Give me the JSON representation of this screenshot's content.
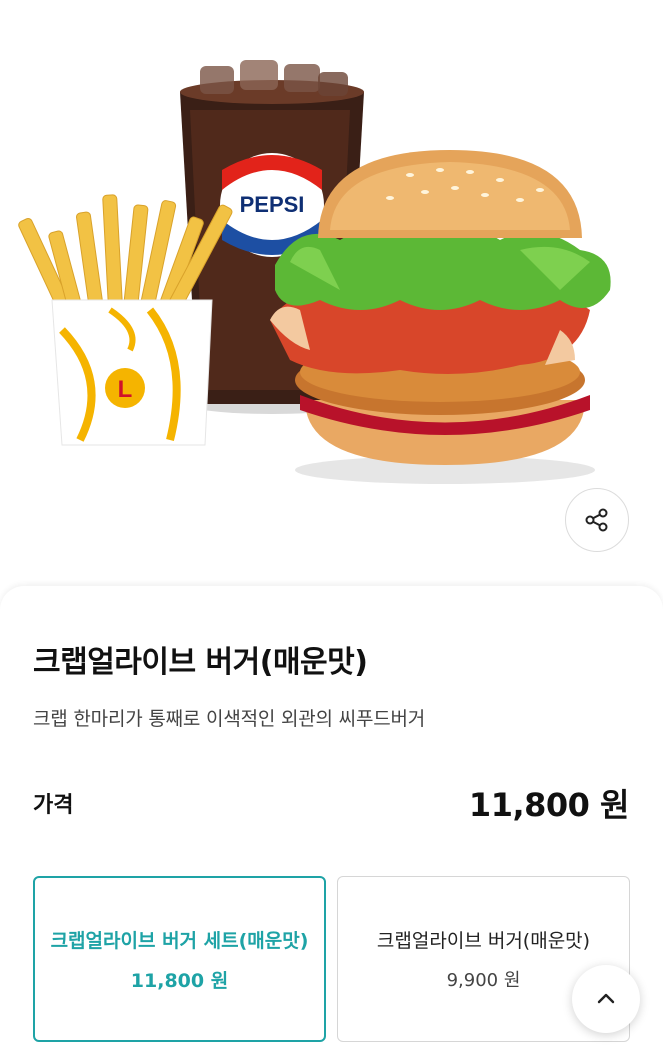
{
  "product": {
    "name": "크랩얼라이브 버거(매운맛)",
    "description": "크랩 한마리가 통째로 이색적인 외관의 씨푸드버거",
    "price_label": "가격",
    "price_value": "11,800 원",
    "cup_logo_text": "PEPSI",
    "fries_box_logo": "L"
  },
  "options": [
    {
      "name": "크랩얼라이브 버거 세트(매운맛)",
      "price": "11,800 원",
      "selected": true
    },
    {
      "name": "크랩얼라이브 버거(매운맛)",
      "price": "9,900 원",
      "selected": false
    }
  ],
  "icons": {
    "share": "share-icon",
    "scroll_top": "chevron-up-icon"
  },
  "colors": {
    "accent": "#1ea3a6",
    "text": "#111111"
  }
}
